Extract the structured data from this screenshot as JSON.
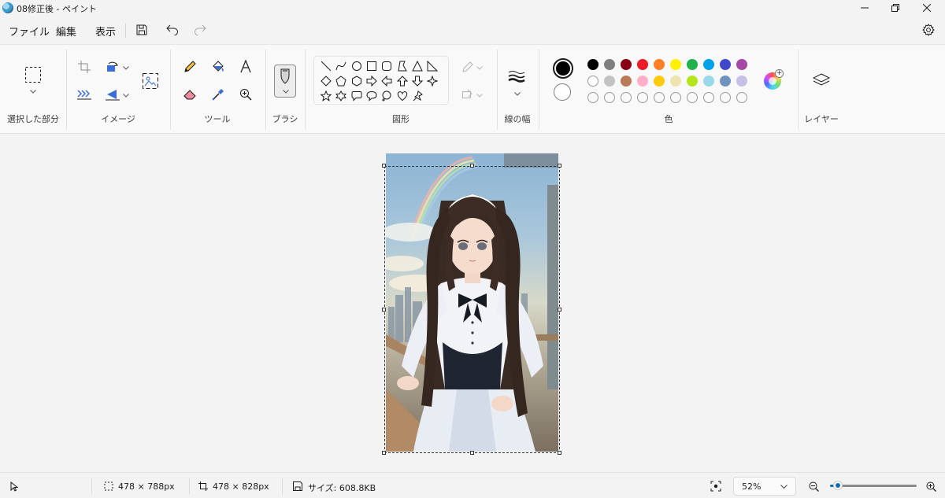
{
  "window": {
    "title": "08修正後 - ペイント"
  },
  "menu": {
    "file": "ファイル",
    "edit": "編集",
    "view": "表示"
  },
  "ribbon": {
    "groups": {
      "selection": "選択した部分",
      "image": "イメージ",
      "tools": "ツール",
      "brush": "ブラシ",
      "shapes": "図形",
      "line_width": "線の幅",
      "colors": "色",
      "layers": "レイヤー"
    },
    "primary_color": "#000000",
    "secondary_color": "#ffffff",
    "palette": [
      [
        "#000000",
        "#7f7f7f",
        "#880015",
        "#ed1c24",
        "#ff7f27",
        "#fff200",
        "#22b14c",
        "#00a2e8",
        "#3f48cc",
        "#a349a4"
      ],
      [
        "#ffffff",
        "#c3c3c3",
        "#b97a57",
        "#ffaec9",
        "#ffc90e",
        "#efe4b0",
        "#b5e61d",
        "#99d9ea",
        "#7092be",
        "#c8bfe7"
      ],
      [
        "",
        "",
        "",
        "",
        "",
        "",
        "",
        "",
        "",
        ""
      ]
    ]
  },
  "status": {
    "selection_size": "478 × 788px",
    "canvas_size": "478 × 828px",
    "file_size": "サイズ: 608.8KB",
    "zoom": "52%",
    "zoom_level": 0.52
  }
}
